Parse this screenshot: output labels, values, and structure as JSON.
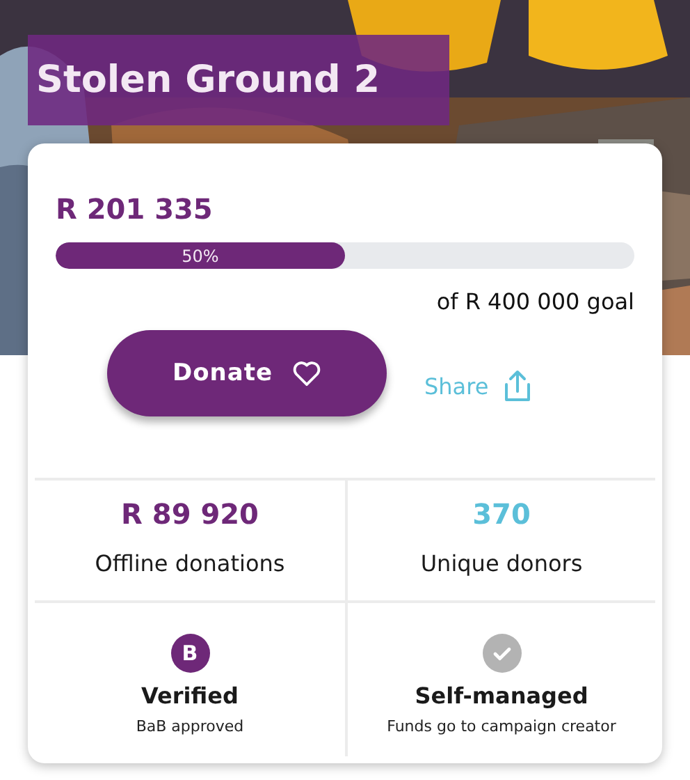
{
  "banner": {
    "kind": "picture",
    "title": "Stolen Ground 2"
  },
  "campaign": {
    "raised": "R 201 335",
    "progress": {
      "level": 0.5,
      "label": "50%"
    },
    "goal": "of R 400 000 goal",
    "donate_button": "Donate",
    "share_link": "Share"
  },
  "stats": [
    {
      "value": "R 89 920",
      "label": "Offline donations",
      "color": "#6e2878"
    },
    {
      "value": "370",
      "label": "Unique donors",
      "color": "#5bbfd9"
    }
  ],
  "badges": [
    {
      "kind": "letter",
      "letter": "B",
      "title": "Verified",
      "subtitle": "BaB approved",
      "color": "#6e2878"
    },
    {
      "kind": "check",
      "title": "Self-managed",
      "subtitle": "Funds go to campaign creator",
      "color": "#b3b3b3"
    }
  ]
}
